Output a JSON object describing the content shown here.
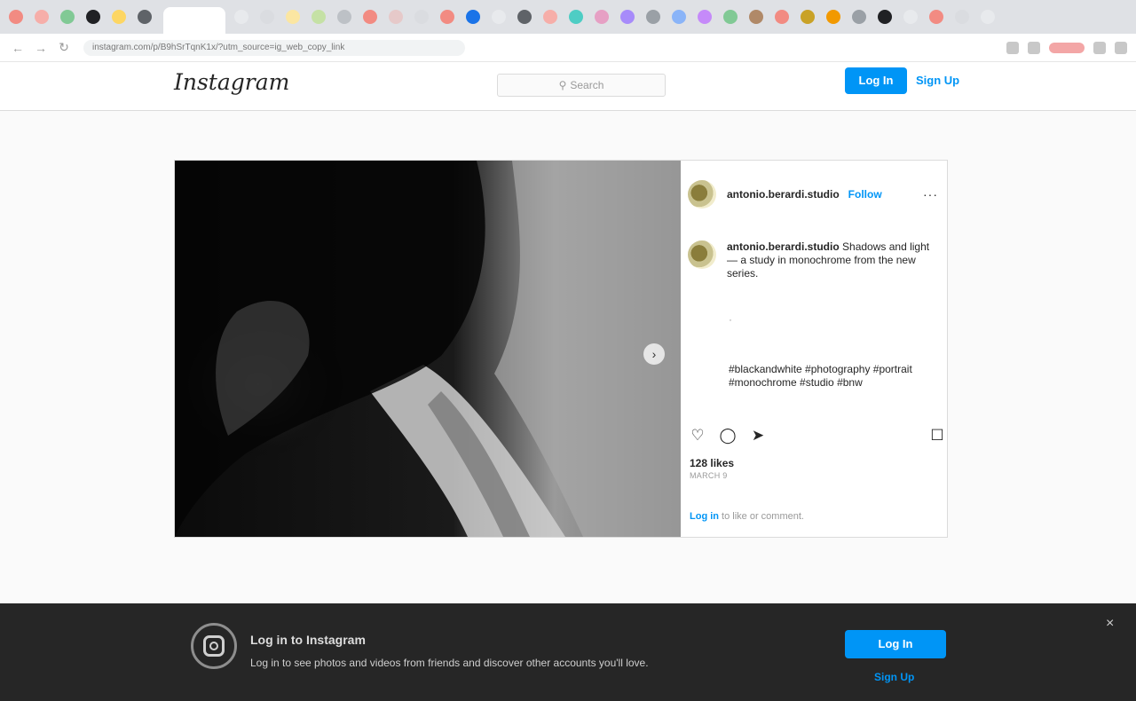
{
  "browser": {
    "tab_colors": [
      "#f28b82",
      "#f6aea9",
      "#81c995",
      "#202124",
      "#fdd663",
      "#5f6368",
      "#ffffff",
      "#e8eaed",
      "#dadce0",
      "#fbe6a2",
      "#c5e1a5",
      "#bdc1c6",
      "#f28b82",
      "#e6c9c9",
      "#dadce0",
      "#f28b82",
      "#1a73e8",
      "#e8eaed",
      "#5f6368",
      "#f6aea9",
      "#4ecdc4",
      "#e6a0c4",
      "#a78bfa",
      "#9aa0a6",
      "#8ab4f8",
      "#c58af9",
      "#81c995",
      "#b08968",
      "#f28b82",
      "#c9a227",
      "#f29900",
      "#9aa0a6",
      "#202124",
      "#e8eaed",
      "#f28b82",
      "#dadce0",
      "#e8eaed"
    ],
    "url": "instagram.com/p/B9hSrTqnK1x/?utm_source=ig_web_copy_link",
    "back_icon": "arrow-left-icon",
    "forward_icon": "arrow-right-icon",
    "reload_icon": "reload-icon"
  },
  "header": {
    "logo": "Instagram",
    "search_placeholder": "Search",
    "login_label": "Log In",
    "signup_label": "Sign Up"
  },
  "post": {
    "username": "antonio.berardi.studio",
    "follow_label": "Follow",
    "more_icon": "···",
    "caption_user": "antonio.berardi.studio",
    "caption_text": "Shadows and light — a study in monochrome from the new series.",
    "caption_mid": "·",
    "tags": "#blackandwhite #photography #portrait #monochrome #studio #bnw",
    "likes": "128 likes",
    "date": "MARCH 9",
    "login_prompt_link": "Log in",
    "login_prompt_rest": " to like or comment."
  },
  "banner": {
    "title": "Log in to Instagram",
    "subtitle": "Log in to see photos and videos from friends and discover other accounts you'll love.",
    "login_label": "Log In",
    "signup_label": "Sign Up",
    "close_icon": "×"
  }
}
